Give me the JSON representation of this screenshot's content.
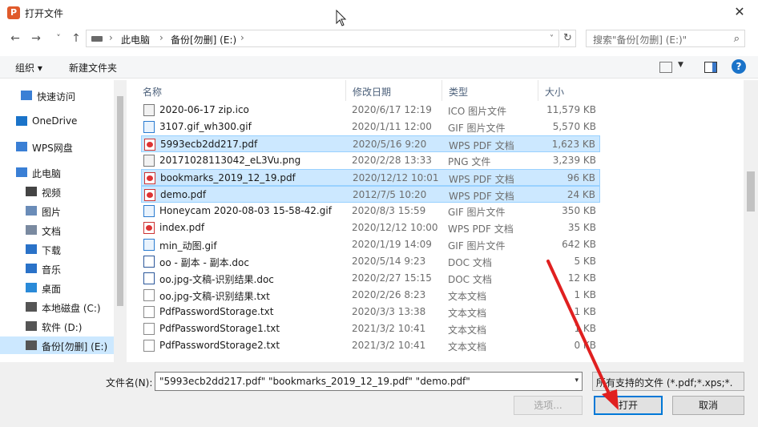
{
  "window": {
    "title": "打开文件",
    "close_glyph": "✕",
    "app_icon_letter": "P"
  },
  "nav": {
    "back": "←",
    "forward": "→",
    "recent": "˅",
    "up": "↑",
    "path": [
      "此电脑",
      "备份[勿删] (E:)"
    ],
    "separators": [
      "›",
      "›",
      "›"
    ],
    "refresh": "↻",
    "search_placeholder": "搜索\"备份[勿删] (E:)\"",
    "search_icon": "⚲"
  },
  "toolbar": {
    "organize": "组织 ▾",
    "new_folder": "新建文件夹",
    "view_dropdown": "▼",
    "help": "?"
  },
  "sidebar": {
    "items": [
      {
        "label": "快速访问",
        "icon": "star-icon",
        "color": "#3a7fd5"
      },
      {
        "label": "OneDrive",
        "icon": "cloud-icon",
        "color": "#1a73c9"
      },
      {
        "label": "WPS网盘",
        "icon": "cloud-icon",
        "color": "#3a7fd5"
      },
      {
        "label": "此电脑",
        "icon": "computer-icon",
        "color": "#3a7fd5"
      },
      {
        "label": "视频",
        "icon": "video-icon",
        "color": "#444444"
      },
      {
        "label": "图片",
        "icon": "picture-icon",
        "color": "#6a8cb8"
      },
      {
        "label": "文档",
        "icon": "document-icon",
        "color": "#7a8aa0"
      },
      {
        "label": "下载",
        "icon": "download-icon",
        "color": "#2a72c8"
      },
      {
        "label": "音乐",
        "icon": "music-icon",
        "color": "#2a72c8"
      },
      {
        "label": "桌面",
        "icon": "desktop-icon",
        "color": "#2a8ad8"
      },
      {
        "label": "本地磁盘 (C:)",
        "icon": "drive-icon",
        "color": "#555555"
      },
      {
        "label": "软件 (D:)",
        "icon": "drive-icon",
        "color": "#555555"
      },
      {
        "label": "备份[勿删] (E:)",
        "icon": "drive-icon",
        "color": "#555555"
      }
    ]
  },
  "columns": {
    "name": "名称",
    "date": "修改日期",
    "type": "类型",
    "size": "大小",
    "sort_arrow": "^"
  },
  "files": [
    {
      "name": "2020-06-17 zip.ico",
      "date": "2020/6/17 12:19",
      "type": "ICO 图片文件",
      "size": "11,579 KB",
      "icon": "img",
      "selected": false
    },
    {
      "name": "3107.gif_wh300.gif",
      "date": "2020/1/11 12:00",
      "type": "GIF 图片文件",
      "size": "5,570 KB",
      "icon": "gif",
      "selected": false
    },
    {
      "name": "5993ecb2dd217.pdf",
      "date": "2020/5/16 9:20",
      "type": "WPS PDF 文档",
      "size": "1,623 KB",
      "icon": "pdf",
      "selected": true
    },
    {
      "name": "20171028113042_eL3Vu.png",
      "date": "2020/2/28 13:33",
      "type": "PNG 文件",
      "size": "3,239 KB",
      "icon": "img",
      "selected": false
    },
    {
      "name": "bookmarks_2019_12_19.pdf",
      "date": "2020/12/12 10:01",
      "type": "WPS PDF 文档",
      "size": "96 KB",
      "icon": "pdf",
      "selected": true
    },
    {
      "name": "demo.pdf",
      "date": "2012/7/5 10:20",
      "type": "WPS PDF 文档",
      "size": "24 KB",
      "icon": "pdf",
      "selected": true
    },
    {
      "name": "Honeycam 2020-08-03 15-58-42.gif",
      "date": "2020/8/3 15:59",
      "type": "GIF 图片文件",
      "size": "350 KB",
      "icon": "gif",
      "selected": false
    },
    {
      "name": "index.pdf",
      "date": "2020/12/12 10:00",
      "type": "WPS PDF 文档",
      "size": "35 KB",
      "icon": "pdf",
      "selected": false
    },
    {
      "name": "min_动图.gif",
      "date": "2020/1/19 14:09",
      "type": "GIF 图片文件",
      "size": "642 KB",
      "icon": "gif",
      "selected": false
    },
    {
      "name": "oo - 副本 - 副本.doc",
      "date": "2020/5/14 9:23",
      "type": "DOC 文档",
      "size": "5 KB",
      "icon": "doc",
      "selected": false
    },
    {
      "name": "oo.jpg-文稿-识别结果.doc",
      "date": "2020/2/27 15:15",
      "type": "DOC 文档",
      "size": "12 KB",
      "icon": "doc",
      "selected": false
    },
    {
      "name": "oo.jpg-文稿-识别结果.txt",
      "date": "2020/2/26 8:23",
      "type": "文本文档",
      "size": "1 KB",
      "icon": "txt",
      "selected": false
    },
    {
      "name": "PdfPasswordStorage.txt",
      "date": "2020/3/3 13:38",
      "type": "文本文档",
      "size": "1 KB",
      "icon": "txt",
      "selected": false
    },
    {
      "name": "PdfPasswordStorage1.txt",
      "date": "2021/3/2 10:41",
      "type": "文本文档",
      "size": "1 KB",
      "icon": "txt",
      "selected": false
    },
    {
      "name": "PdfPasswordStorage2.txt",
      "date": "2021/3/2 10:41",
      "type": "文本文档",
      "size": "0 KB",
      "icon": "txt",
      "selected": false
    }
  ],
  "footer": {
    "filename_label": "文件名(N):",
    "filename_value": "\"5993ecb2dd217.pdf\" \"bookmarks_2019_12_19.pdf\" \"demo.pdf\"",
    "filter_value": "所有支持的文件 (*.pdf;*.xps;*.",
    "options_button": "选项...",
    "open_button": "打开",
    "cancel_button": "取消",
    "dropdown_glyph": "▾"
  },
  "colors": {
    "selection": "#cce8ff",
    "accent": "#0078d7",
    "annotation_arrow": "#e02020"
  }
}
